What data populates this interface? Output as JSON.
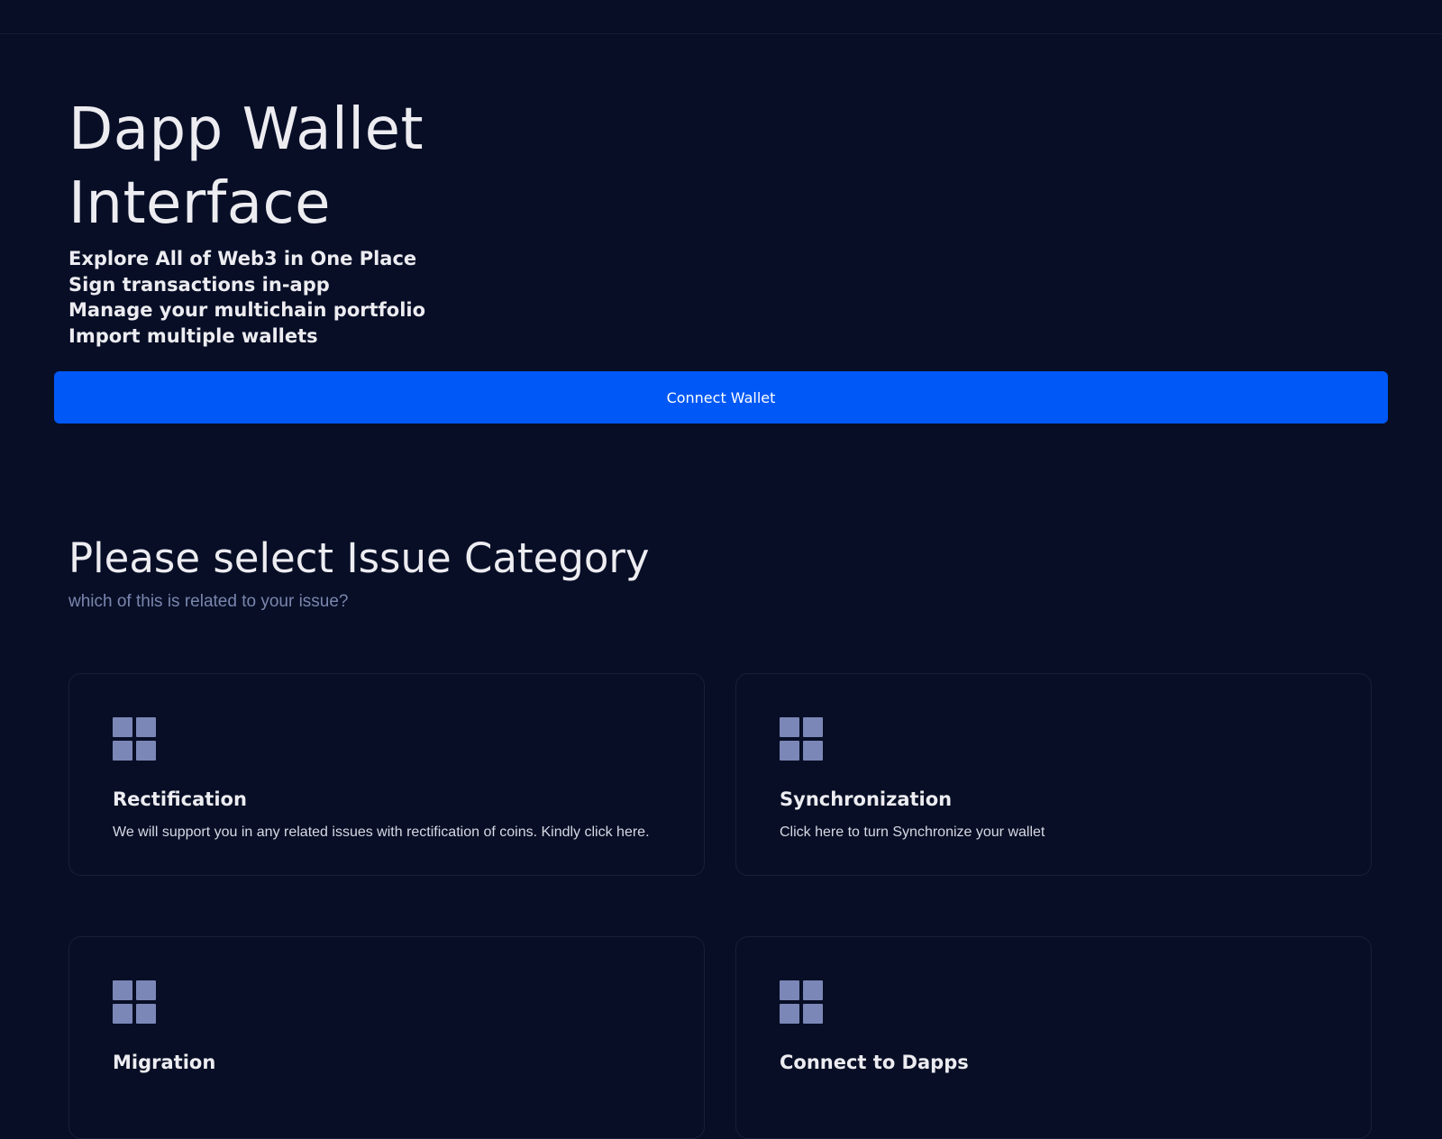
{
  "hero": {
    "title": "Dapp Wallet Interface",
    "features": [
      "Explore All of Web3 in One Place",
      "Sign transactions in-app",
      "Manage your multichain portfolio",
      "Import multiple wallets"
    ],
    "connect_label": "Connect Wallet"
  },
  "issues": {
    "title": "Please select Issue Category",
    "subtitle": "which of this is related to your issue?",
    "cards": [
      {
        "title": "Rectification",
        "description": "We will support you in any related issues with rectification of coins. Kindly click here.",
        "icon": "grid-icon"
      },
      {
        "title": "Synchronization",
        "description": "Click here to turn Synchronize your wallet",
        "icon": "grid-icon"
      },
      {
        "title": "Migration",
        "description": "",
        "icon": "grid-icon"
      },
      {
        "title": "Connect to Dapps",
        "description": "",
        "icon": "grid-icon"
      }
    ]
  },
  "colors": {
    "background": "#070e26",
    "accent": "#0058f6",
    "icon": "#7b87b7",
    "muted_text": "#7a86ad",
    "card_border": "#182038"
  }
}
